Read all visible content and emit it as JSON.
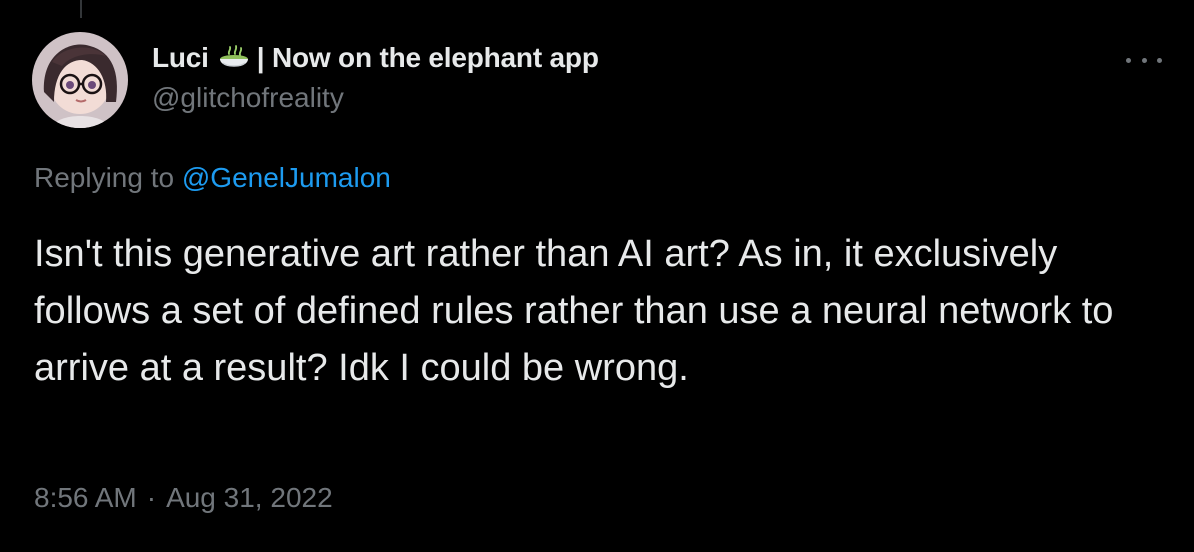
{
  "tweet": {
    "display_name": "Luci",
    "emoji_icon": "matcha-bowl-icon",
    "name_suffix": "| Now on the elephant app",
    "handle": "@glitchofreality",
    "reply_prefix": "Replying to ",
    "reply_mention": "@GenelJumalon",
    "text": "Isn't this generative art rather than AI art? As in, it exclusively follows a set of defined rules rather than use a neural network to arrive at a result? Idk I could be wrong.",
    "time": "8:56 AM",
    "separator": "·",
    "date": "Aug 31, 2022"
  },
  "colors": {
    "background": "#000000",
    "primary_text": "#e7e9ea",
    "secondary_text": "#71767b",
    "link": "#1d9bf0"
  }
}
